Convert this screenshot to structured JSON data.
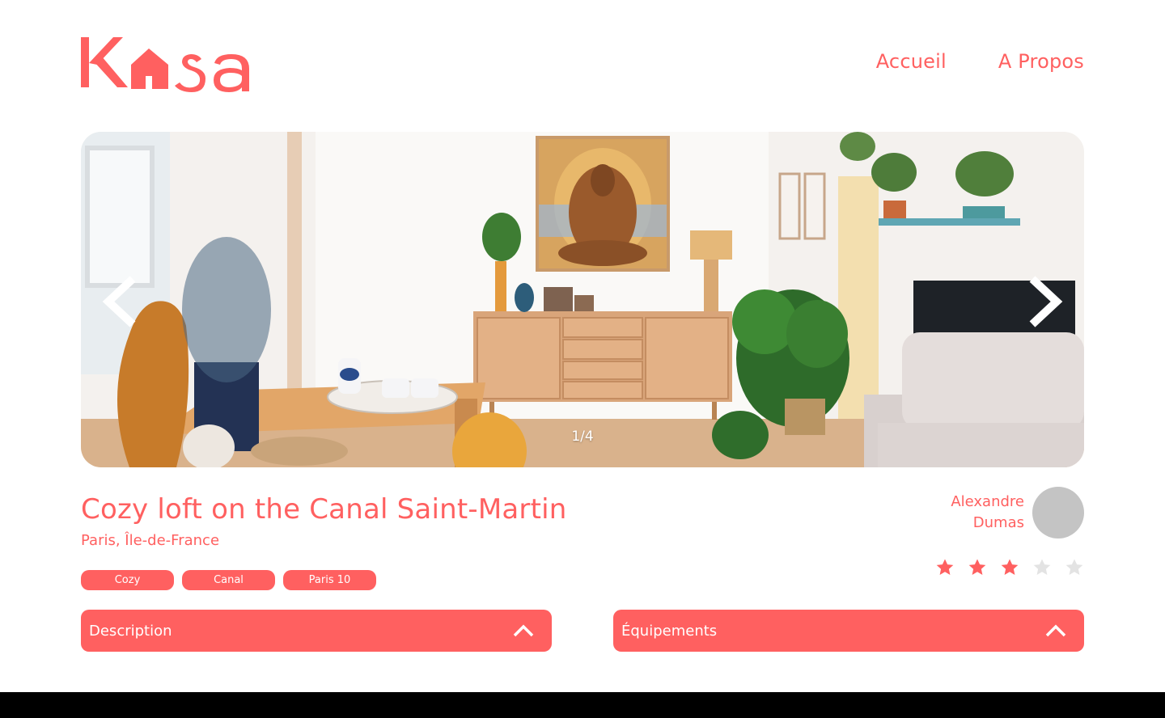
{
  "brand": {
    "logo_text": "Kasa",
    "accent": "#FF6060"
  },
  "nav": {
    "home": "Accueil",
    "about": "A Propos"
  },
  "gallery": {
    "counter": "1/4",
    "prev_icon": "chevron-left-icon",
    "next_icon": "chevron-right-icon"
  },
  "listing": {
    "title": "Cozy loft on the Canal Saint-Martin",
    "location": "Paris, Île-de-France",
    "tags": [
      "Cozy",
      "Canal",
      "Paris 10"
    ]
  },
  "host": {
    "first_name": "Alexandre",
    "last_name": "Dumas"
  },
  "rating": {
    "value": 3,
    "max": 5,
    "filled_color": "#FF6060",
    "empty_color": "#E3E3E3"
  },
  "collapses": {
    "description": "Description",
    "equipments": "Équipements"
  }
}
